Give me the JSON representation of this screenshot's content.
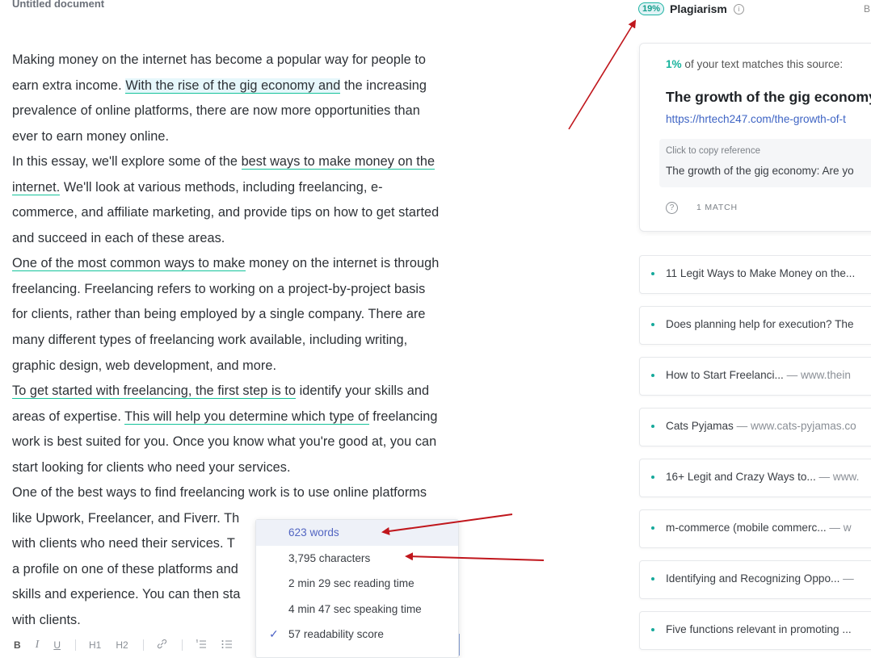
{
  "document": {
    "title": "Untitled document",
    "lines": [
      [
        {
          "t": "Making money on the internet has become a popular way for people to"
        }
      ],
      [
        {
          "t": "earn extra income. "
        },
        {
          "t": "With the rise of the gig economy and",
          "hl": "sel"
        },
        {
          "t": " the increasing"
        }
      ],
      [
        {
          "t": "prevalence of online platforms, there are now more opportunities than"
        }
      ],
      [
        {
          "t": "ever to earn money online."
        }
      ],
      [
        {
          "t": "In this essay, we'll explore some of the "
        },
        {
          "t": "best ways to make money on the ",
          "hl": "u"
        }
      ],
      [
        {
          "t": "internet.",
          "hl": "u"
        },
        {
          "t": " We'll look at various methods, including freelancing, e-"
        }
      ],
      [
        {
          "t": "commerce, and affiliate marketing, and provide tips on how to get started"
        }
      ],
      [
        {
          "t": "and succeed in each of these areas."
        }
      ],
      [
        {
          "t": "One of the most common ways to make",
          "hl": "u"
        },
        {
          "t": " money on the internet is through"
        }
      ],
      [
        {
          "t": "freelancing. Freelancing refers to working on a project-by-project basis"
        }
      ],
      [
        {
          "t": "for clients, rather than being employed by a single company. There are"
        }
      ],
      [
        {
          "t": "many different types of freelancing work available, including writing,"
        }
      ],
      [
        {
          "t": "graphic design, web development, and more."
        }
      ],
      [
        {
          "t": "To get started with freelancing, the first step is to",
          "hl": "u"
        },
        {
          "t": " identify your skills and"
        }
      ],
      [
        {
          "t": "areas of expertise. "
        },
        {
          "t": "This will help you determine which type of",
          "hl": "u"
        },
        {
          "t": " freelancing"
        }
      ],
      [
        {
          "t": "work is best suited for you. Once you know what you're good at, you can"
        }
      ],
      [
        {
          "t": "start looking for clients who need your services."
        }
      ],
      [
        {
          "t": "One of the best ways to find freelancing work is to use online platforms"
        }
      ],
      [
        {
          "t": "like Upwork, Freelancer, and Fiverr. Th"
        }
      ],
      [
        {
          "t": "with clients who need their services. T"
        }
      ],
      [
        {
          "t": "a profile on one of these platforms and"
        }
      ],
      [
        {
          "t": "skills and experience. You can then sta"
        }
      ],
      [
        {
          "t": "with clients."
        }
      ]
    ]
  },
  "toolbar": {
    "bold": "B",
    "italic": "I",
    "underline": "U",
    "h1": "H1",
    "h2": "H2",
    "link_icon": "link-icon",
    "ordered_list_icon": "ordered-list-icon",
    "bullet_list_icon": "bullet-list-icon"
  },
  "stats_popup": {
    "words": "623 words",
    "characters": "3,795 characters",
    "reading_time": "2 min 29 sec reading time",
    "speaking_time": "4 min 47 sec speaking time",
    "readability": "57 readability score",
    "check_glyph": "✓"
  },
  "plagiarism": {
    "badge": "19%",
    "title": "Plagiarism",
    "header_extra": "B",
    "card": {
      "match_pct": "1%",
      "match_text": " of your text matches this source:",
      "source_title": "The growth of the gig economy",
      "source_url": "https://hrtech247.com/the-growth-of-t",
      "ref_label": "Click to copy reference",
      "ref_text": "The growth of the gig economy: Are yo",
      "match_count": "1 MATCH"
    },
    "sources": [
      {
        "title": "11 Legit Ways to Make Money on the...",
        "domain": ""
      },
      {
        "title": "Does planning help for execution? The",
        "domain": ""
      },
      {
        "title": "How to Start Freelanci... ",
        "domain": "— www.thein"
      },
      {
        "title": "Cats Pyjamas ",
        "domain": "— www.cats-pyjamas.co"
      },
      {
        "title": "16+ Legit and Crazy Ways to... ",
        "domain": "— www."
      },
      {
        "title": "m-commerce (mobile commerc... ",
        "domain": "— w"
      },
      {
        "title": "Identifying and Recognizing Oppo... ",
        "domain": "—"
      },
      {
        "title": "Five functions relevant in promoting ...",
        "domain": ""
      }
    ]
  },
  "colors": {
    "accent_green": "#15c39a",
    "link_blue": "#3e64c4",
    "arrow_red": "#c0161c"
  }
}
